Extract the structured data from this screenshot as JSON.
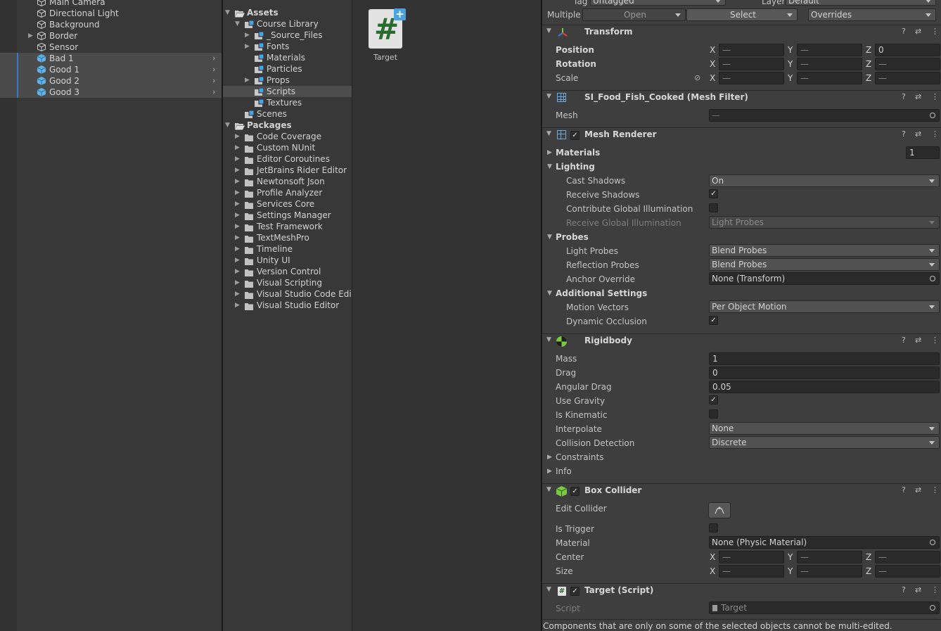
{
  "hierarchy": {
    "items": [
      {
        "label": "Main Camera",
        "icon": "cube-outline-icon",
        "selected": false,
        "arrow": false
      },
      {
        "label": "Directional Light",
        "icon": "cube-outline-icon",
        "selected": false,
        "arrow": false
      },
      {
        "label": "Background",
        "icon": "cube-outline-icon",
        "selected": false,
        "arrow": false
      },
      {
        "label": "Border",
        "icon": "cube-outline-icon",
        "selected": false,
        "arrow": true
      },
      {
        "label": "Sensor",
        "icon": "cube-outline-icon",
        "selected": false,
        "arrow": false
      },
      {
        "label": "Bad 1",
        "icon": "prefab-cube-icon",
        "selected": true,
        "arrow": false
      },
      {
        "label": "Good 1",
        "icon": "prefab-cube-icon",
        "selected": true,
        "arrow": false
      },
      {
        "label": "Good 2",
        "icon": "prefab-cube-icon",
        "selected": true,
        "arrow": false
      },
      {
        "label": "Good 3",
        "icon": "prefab-cube-icon",
        "selected": true,
        "arrow": false
      }
    ]
  },
  "project": {
    "items": [
      {
        "label": "Assets",
        "depth": 0,
        "arrow": "down",
        "icon": "open-folder-icon",
        "bold": true
      },
      {
        "label": "Course Library",
        "depth": 1,
        "arrow": "down",
        "icon": "package-folder-icon"
      },
      {
        "label": "_Source_Files",
        "depth": 2,
        "arrow": "right",
        "icon": "package-folder-icon"
      },
      {
        "label": "Fonts",
        "depth": 2,
        "arrow": "right",
        "icon": "package-folder-icon"
      },
      {
        "label": "Materials",
        "depth": 2,
        "arrow": "",
        "icon": "package-folder-icon"
      },
      {
        "label": "Particles",
        "depth": 2,
        "arrow": "",
        "icon": "package-folder-icon"
      },
      {
        "label": "Props",
        "depth": 2,
        "arrow": "right",
        "icon": "package-folder-icon"
      },
      {
        "label": "Scripts",
        "depth": 2,
        "arrow": "",
        "icon": "package-folder-icon",
        "selected": true
      },
      {
        "label": "Textures",
        "depth": 2,
        "arrow": "",
        "icon": "package-folder-icon"
      },
      {
        "label": "Scenes",
        "depth": 1,
        "arrow": "",
        "icon": "package-folder-icon"
      },
      {
        "label": "Packages",
        "depth": 0,
        "arrow": "down",
        "icon": "open-folder-icon",
        "bold": true
      },
      {
        "label": "Code Coverage",
        "depth": 1,
        "arrow": "right",
        "icon": "folder-icon"
      },
      {
        "label": "Custom NUnit",
        "depth": 1,
        "arrow": "right",
        "icon": "folder-icon"
      },
      {
        "label": "Editor Coroutines",
        "depth": 1,
        "arrow": "right",
        "icon": "folder-icon"
      },
      {
        "label": "JetBrains Rider Editor",
        "depth": 1,
        "arrow": "right",
        "icon": "folder-icon"
      },
      {
        "label": "Newtonsoft Json",
        "depth": 1,
        "arrow": "right",
        "icon": "folder-icon"
      },
      {
        "label": "Profile Analyzer",
        "depth": 1,
        "arrow": "right",
        "icon": "folder-icon"
      },
      {
        "label": "Services Core",
        "depth": 1,
        "arrow": "right",
        "icon": "folder-icon"
      },
      {
        "label": "Settings Manager",
        "depth": 1,
        "arrow": "right",
        "icon": "folder-icon"
      },
      {
        "label": "Test Framework",
        "depth": 1,
        "arrow": "right",
        "icon": "folder-icon"
      },
      {
        "label": "TextMeshPro",
        "depth": 1,
        "arrow": "right",
        "icon": "folder-icon"
      },
      {
        "label": "Timeline",
        "depth": 1,
        "arrow": "right",
        "icon": "folder-icon"
      },
      {
        "label": "Unity UI",
        "depth": 1,
        "arrow": "right",
        "icon": "folder-icon"
      },
      {
        "label": "Version Control",
        "depth": 1,
        "arrow": "right",
        "icon": "folder-icon"
      },
      {
        "label": "Visual Scripting",
        "depth": 1,
        "arrow": "right",
        "icon": "folder-icon"
      },
      {
        "label": "Visual Studio Code Editor",
        "depth": 1,
        "arrow": "right",
        "icon": "folder-icon"
      },
      {
        "label": "Visual Studio Editor",
        "depth": 1,
        "arrow": "right",
        "icon": "folder-icon"
      }
    ]
  },
  "asset_panel": {
    "item_label": "Target",
    "icon": "csharp-script-icon"
  },
  "inspector": {
    "top": {
      "tag_label": "Tag",
      "tag_value": "Untagged",
      "layer_label": "Layer",
      "layer_value": "Default",
      "multiple_label": "Multiple",
      "open_label": "Open",
      "select_label": "Select",
      "overrides_label": "Overrides"
    },
    "transform": {
      "title": "Transform",
      "position_label": "Position",
      "rotation_label": "Rotation",
      "scale_label": "Scale",
      "x": "X",
      "y": "Y",
      "z": "Z",
      "mixed": "—",
      "position_z": "0"
    },
    "mesh_filter": {
      "title": "SI_Food_Fish_Cooked (Mesh Filter)",
      "mesh_label": "Mesh",
      "mesh_value": "—"
    },
    "mesh_renderer": {
      "title": "Mesh Renderer",
      "materials_label": "Materials",
      "materials_count": "1",
      "lighting_label": "Lighting",
      "cast_shadows_label": "Cast Shadows",
      "cast_shadows_value": "On",
      "receive_shadows_label": "Receive Shadows",
      "contribute_gi_label": "Contribute Global Illumination",
      "receive_gi_label": "Receive Global Illumination",
      "receive_gi_value": "Light Probes",
      "probes_label": "Probes",
      "light_probes_label": "Light Probes",
      "light_probes_value": "Blend Probes",
      "reflection_probes_label": "Reflection Probes",
      "reflection_probes_value": "Blend Probes",
      "anchor_override_label": "Anchor Override",
      "anchor_override_value": "None (Transform)",
      "additional_label": "Additional Settings",
      "motion_vectors_label": "Motion Vectors",
      "motion_vectors_value": "Per Object Motion",
      "dynamic_occlusion_label": "Dynamic Occlusion"
    },
    "rigidbody": {
      "title": "Rigidbody",
      "mass_label": "Mass",
      "mass_value": "1",
      "drag_label": "Drag",
      "drag_value": "0",
      "angular_drag_label": "Angular Drag",
      "angular_drag_value": "0.05",
      "use_gravity_label": "Use Gravity",
      "is_kinematic_label": "Is Kinematic",
      "interpolate_label": "Interpolate",
      "interpolate_value": "None",
      "collision_label": "Collision Detection",
      "collision_value": "Discrete",
      "constraints_label": "Constraints",
      "info_label": "Info"
    },
    "box_collider": {
      "title": "Box Collider",
      "edit_label": "Edit Collider",
      "is_trigger_label": "Is Trigger",
      "material_label": "Material",
      "material_value": "None (Physic Material)",
      "center_label": "Center",
      "size_label": "Size"
    },
    "target_script": {
      "title": "Target (Script)",
      "script_label": "Script",
      "script_value": "Target"
    },
    "footer": "Components that are only on some of the selected objects cannot be multi-edited.",
    "colors": {
      "selection": "#3a79bb",
      "panel": "#3e3e3e",
      "field": "#2a2a2a"
    }
  }
}
